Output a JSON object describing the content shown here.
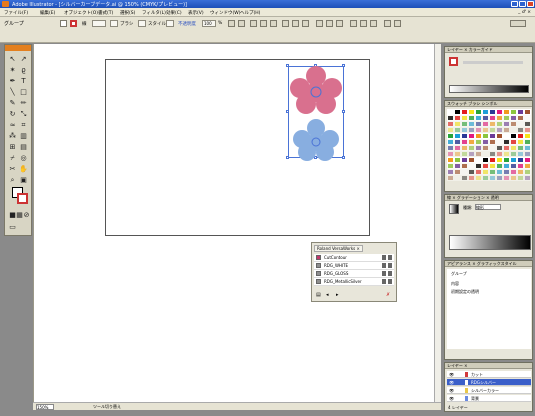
{
  "window": {
    "title": "Adobe Illustrator - [シルバーカーブデータ.ai @ 150% (CMYK/プレビュー)]",
    "controls": [
      "_",
      "□",
      "×"
    ]
  },
  "menubar": {
    "items": [
      "ファイル(F)",
      "編集(E)",
      "オブジェクト(O)",
      "書式(T)",
      "選択(S)",
      "フィルタ(L)",
      "効果(C)",
      "表示(V)",
      "ウィンドウ(W)",
      "ヘルプ(H)"
    ],
    "doc_controls": "_ ♂ ×"
  },
  "controlbar": {
    "group_label": "グループ",
    "stroke_label": "線",
    "brush_label": "ブラシ",
    "style_label": "スタイル",
    "opacity_label": "不透明度",
    "opacity_value": "100",
    "opacity_unit": "%"
  },
  "swatches_palette": {
    "tab_label": "Roland VersaWorks ×",
    "items": [
      {
        "name": "CutContour",
        "color": "#c23a6c"
      },
      {
        "name": "RDG_WHITE",
        "color": "#8e8e8e"
      },
      {
        "name": "RDG_GLOSS",
        "color": "#8e8e8e"
      },
      {
        "name": "RDG_MetallicSilver",
        "color": "#8e8e8e"
      }
    ]
  },
  "flowers": {
    "top_color": "#d9708e",
    "bottom_color": "#88aee0",
    "center_color": "#4a73d6"
  },
  "statusbar": {
    "zoom": "150%",
    "status": "ツール切り替え"
  },
  "right_dock": {
    "stroke_panel_tabs": "レイヤー × カラーガイド",
    "swatch_panel_tabs": "スウォッチ ブラシ シンボル",
    "gradient_panel_tabs": "線 × グラデーション × 透明",
    "gradient_type_label": "種類:",
    "gradient_type_value": "線形",
    "appearance_panel_tabs": "アピアランス × グラフィックスタイル",
    "appearance_group": "グループ",
    "appearance_content": "内容",
    "appearance_opacity": "初期設定の透明",
    "layers_panel_tabs": "レイヤー ×",
    "layers": [
      {
        "name": "カット",
        "color": "#d23a3a",
        "active": false
      },
      {
        "name": "RDGシルバー",
        "color": "#3b5fc9",
        "active": true
      },
      {
        "name": "シルバーカラー",
        "color": "#e8c84a",
        "active": false
      },
      {
        "name": "背景",
        "color": "#6a8ae0",
        "active": false
      }
    ],
    "layers_footer": "4 レイヤー"
  }
}
